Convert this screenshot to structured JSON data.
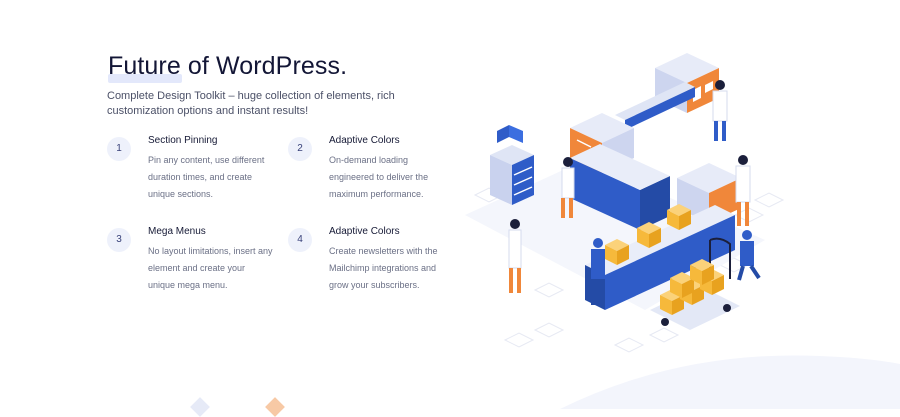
{
  "header": {
    "title": "Future of WordPress.",
    "subtitle": "Complete Design Toolkit – huge collection of elements, rich customization options and instant results!"
  },
  "features": [
    {
      "number": "1",
      "title": "Section Pinning",
      "description": "Pin any content, use different duration times, and create unique sections."
    },
    {
      "number": "2",
      "title": "Adaptive Colors",
      "description": "On-demand loading engineered to deliver the maximum performance."
    },
    {
      "number": "3",
      "title": "Mega Menus",
      "description": "No layout limitations, insert any element and create your unique mega menu."
    },
    {
      "number": "4",
      "title": "Adaptive Colors",
      "description": "Create newsletters with the Mailchimp integrations and grow your subscribers."
    }
  ],
  "colors": {
    "accent_blue": "#2f5cc8",
    "accent_orange": "#f0873a",
    "box_yellow": "#f6b93b",
    "number_bg": "#eef1fb"
  },
  "illustration": {
    "icon": "factory-conveyor-illustration"
  }
}
